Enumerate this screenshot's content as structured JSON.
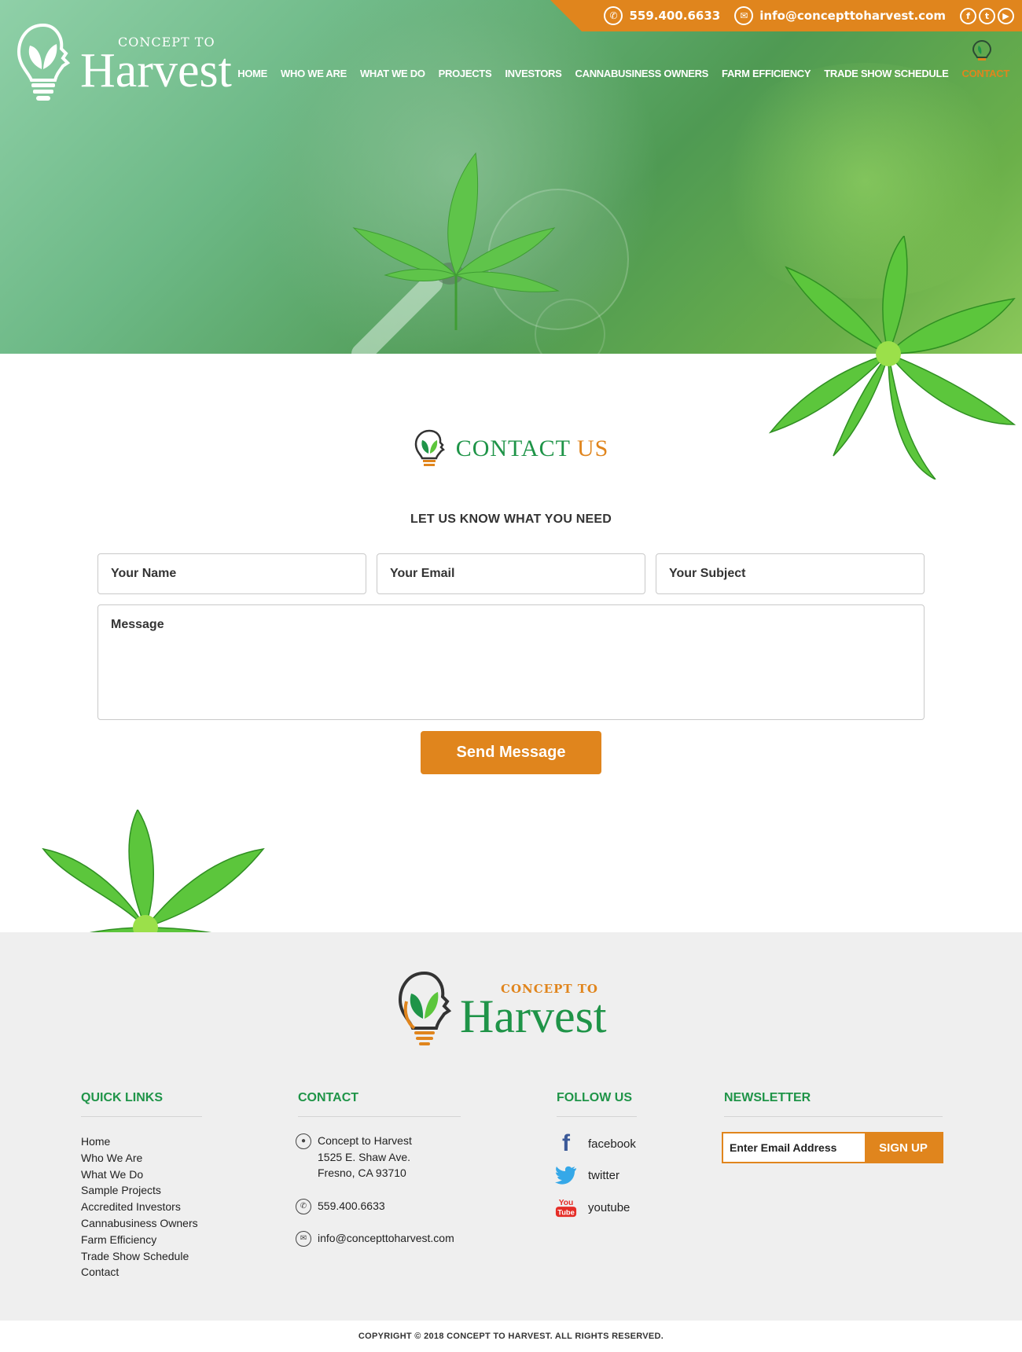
{
  "header": {
    "phone": "559.400.6633",
    "email": "info@concepttoharvest.com",
    "social_icons": [
      "facebook-icon",
      "twitter-icon",
      "youtube-icon"
    ],
    "logo_small": "CONCEPT TO",
    "logo_big": "Harvest"
  },
  "nav": {
    "items": [
      {
        "label": "HOME"
      },
      {
        "label": "WHO WE ARE"
      },
      {
        "label": "WHAT WE DO"
      },
      {
        "label": "PROJECTS"
      },
      {
        "label": "INVESTORS"
      },
      {
        "label": "CANNABUSINESS OWNERS"
      },
      {
        "label": "FARM EFFICIENCY"
      },
      {
        "label": "TRADE SHOW SCHEDULE"
      },
      {
        "label": "CONTACT"
      }
    ],
    "active": "CONTACT"
  },
  "contact": {
    "title_green": "CONTACT",
    "title_orange": "US",
    "subheading": "LET US KNOW WHAT YOU NEED",
    "name_placeholder": "Your Name",
    "email_placeholder": "Your Email",
    "subject_placeholder": "Your Subject",
    "message_placeholder": "Message",
    "send_label": "Send Message"
  },
  "footer": {
    "logo_small": "CONCEPT TO",
    "logo_big": "Harvest",
    "quick_links_heading": "QUICK LINKS",
    "quick_links": [
      "Home",
      "Who We Are",
      "What We Do",
      "Sample Projects",
      "Accredited Investors",
      "Cannabusiness Owners",
      "Farm Efficiency",
      "Trade Show Schedule",
      "Contact"
    ],
    "contact_heading": "CONTACT",
    "address_line1": "Concept to Harvest",
    "address_line2": "1525 E. Shaw Ave.",
    "address_line3": "Fresno, CA 93710",
    "phone": "559.400.6633",
    "email": "info@concepttoharvest.com",
    "follow_heading": "FOLLOW US",
    "social": [
      {
        "label": "facebook",
        "icon": "facebook-icon"
      },
      {
        "label": "twitter",
        "icon": "twitter-icon"
      },
      {
        "label": "youtube",
        "icon": "youtube-icon"
      }
    ],
    "newsletter_heading": "NEWSLETTER",
    "newsletter_placeholder": "Enter Email Address",
    "newsletter_button": "SIGN UP",
    "copyright": "COPYRIGHT © 2018 CONCEPT TO HARVEST. ALL RIGHTS RESERVED."
  },
  "colors": {
    "accent": "#e0851d",
    "brand_green": "#1f9448",
    "footer_bg": "#efefef"
  }
}
